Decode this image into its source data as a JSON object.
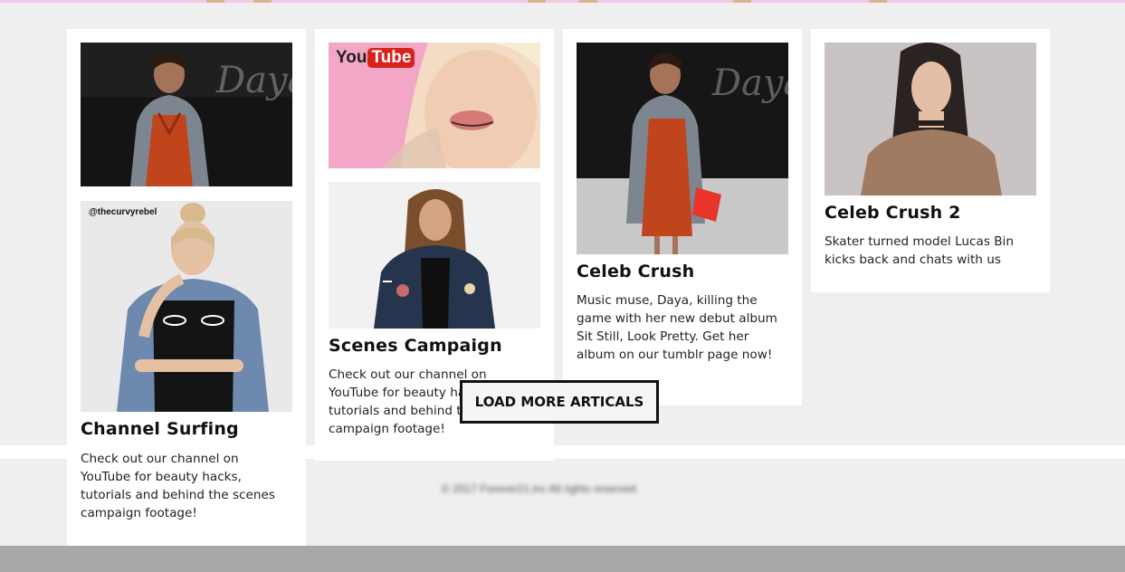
{
  "cards": [
    {
      "title": "Channel Surfing",
      "desc": "Check out our channel on YouTube for beauty hacks, tutorials and behind the scenes campaign footage!",
      "photo_handle": "@thecurvyrebel",
      "top_photo_text": "Daya"
    },
    {
      "title": "Scenes Campaign",
      "desc": "Check out our channel on YouTube for beauty hacks, tutorials and behind the scenes campaign footage!",
      "youtube_logo_you": "You",
      "youtube_logo_tube": "Tube"
    },
    {
      "title": "Celeb Crush",
      "desc": "Music muse, Daya, killing the game with her new debut album Sit Still, Look Pretty. Get her album on our tumblr page now!",
      "top_photo_text": "Daya"
    },
    {
      "title": "Celeb Crush 2",
      "desc": "Skater turned model Lucas Bin kicks back and chats with us"
    }
  ],
  "load_more_label": "LOAD MORE ARTICALS",
  "footer": {
    "copyright": "© 2017 Forever21.inc All rights reserved."
  },
  "colors": {
    "accent_top_strip": "#f0c8e8",
    "button_border": "#111111",
    "footer_bar": "#a8a8a8"
  }
}
